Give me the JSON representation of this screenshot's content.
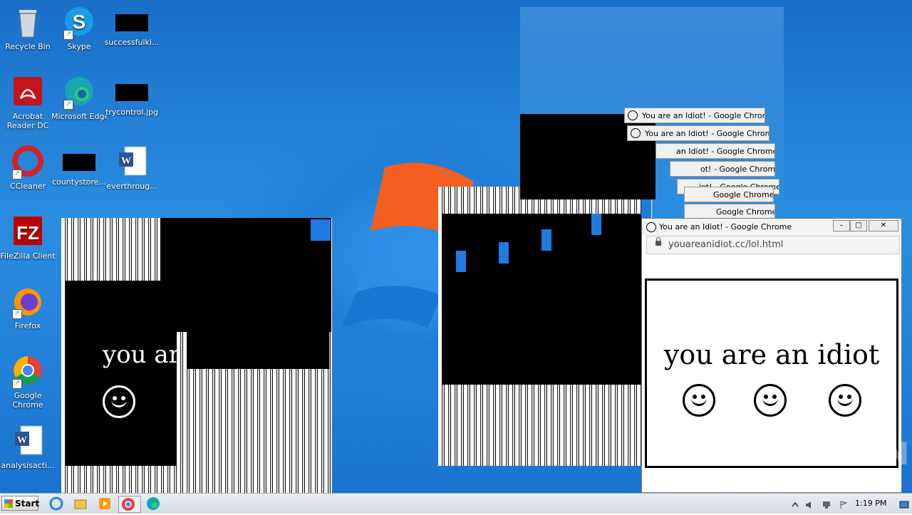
{
  "desktop": {
    "icons": [
      {
        "label": "Recycle Bin"
      },
      {
        "label": "Skype"
      },
      {
        "label": "successfulki..."
      },
      {
        "label": "Acrobat Reader DC"
      },
      {
        "label": "Microsoft Edge"
      },
      {
        "label": "trycontrol.jpg"
      },
      {
        "label": "CCleaner"
      },
      {
        "label": "countystore..."
      },
      {
        "label": "everthroug..."
      },
      {
        "label": "FileZilla Client"
      },
      {
        "label": "Firefox"
      },
      {
        "label": "Google Chrome"
      },
      {
        "label": "analysisacti..."
      }
    ]
  },
  "chrome_tabs": [
    "You are an Idiot! - Google Chrome",
    "You are an Idiot! - Google Chrome",
    "an Idiot! - Google Chrome",
    "ot! - Google Chrome",
    "iot! - Google Chrome",
    "Google Chrome",
    "Google Chrome"
  ],
  "main_window": {
    "title": "You are an Idiot! - Google Chrome",
    "url": "youareanidiot.cc/lol.html",
    "headline": "you are an idiot",
    "min_label": "–",
    "max_label": "□",
    "close_label": "✕"
  },
  "left_window": {
    "headline": "you ar"
  },
  "watermark": "ANY RUN",
  "taskbar": {
    "start_label": "Start",
    "clock": "1:19 PM"
  },
  "colors": {
    "accent_blue": "#1e7be0",
    "desktop_blue": "#1f7fd6"
  }
}
